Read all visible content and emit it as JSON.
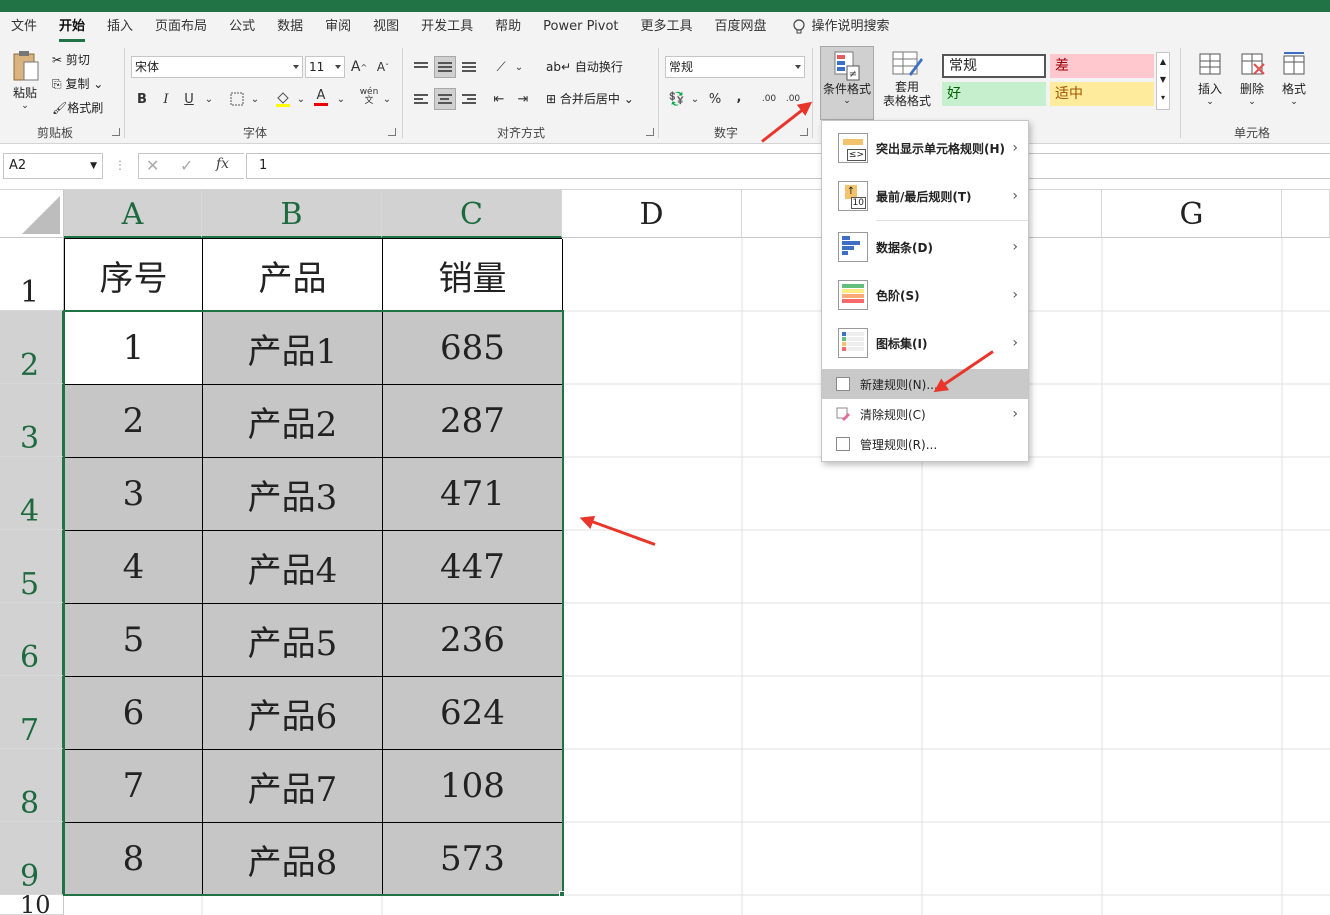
{
  "ribbon_tabs": [
    "文件",
    "开始",
    "插入",
    "页面布局",
    "公式",
    "数据",
    "审阅",
    "视图",
    "开发工具",
    "帮助",
    "Power Pivot",
    "更多工具",
    "百度网盘"
  ],
  "active_tab": "开始",
  "search_label": "操作说明搜索",
  "clipboard": {
    "paste": "粘贴",
    "cut": "剪切",
    "copy": "复制",
    "format_painter": "格式刷",
    "group": "剪贴板"
  },
  "font": {
    "name": "宋体",
    "size": "11",
    "group": "字体",
    "grow": "A",
    "shrink": "A",
    "bold": "B",
    "italic": "I",
    "underline": "U",
    "font_color": "A",
    "phonetic": "wén"
  },
  "alignment": {
    "wrap": "自动换行",
    "merge": "合并后居中",
    "group": "对齐方式"
  },
  "number": {
    "format": "常规",
    "percent": "%",
    "comma": ",",
    "inc_decimal": ".00",
    "dec_decimal": ".00",
    "group": "数字"
  },
  "styles": {
    "conditional": "条件格式",
    "table_format_1": "套用",
    "table_format_2": "表格格式",
    "normal": "常规",
    "bad": "差",
    "good": "好",
    "neutral": "适中"
  },
  "cells": {
    "insert": "插入",
    "delete": "删除",
    "format": "格式",
    "group": "单元格"
  },
  "formula_bar": {
    "name_box": "A2",
    "value": "1",
    "fx": "fx"
  },
  "columns": [
    "A",
    "B",
    "C",
    "D",
    "",
    "G"
  ],
  "rows": [
    "1",
    "2",
    "3",
    "4",
    "5",
    "6",
    "7",
    "8",
    "9",
    "10"
  ],
  "table": {
    "headers": [
      "序号",
      "产品",
      "销量"
    ],
    "rows": [
      [
        "1",
        "产品1",
        "685"
      ],
      [
        "2",
        "产品2",
        "287"
      ],
      [
        "3",
        "产品3",
        "471"
      ],
      [
        "4",
        "产品4",
        "447"
      ],
      [
        "5",
        "产品5",
        "236"
      ],
      [
        "6",
        "产品6",
        "624"
      ],
      [
        "7",
        "产品7",
        "108"
      ],
      [
        "8",
        "产品8",
        "573"
      ]
    ]
  },
  "cf_menu": {
    "highlight": "突出显示单元格规则(H)",
    "topbottom": "最前/最后规则(T)",
    "databar": "数据条(D)",
    "colorscale": "色阶(S)",
    "iconset": "图标集(I)",
    "new_rule": "新建规则(N)...",
    "clear_rules": "清除规则(C)",
    "manage_rules": "管理规则(R)..."
  },
  "colors": {
    "accent": "#217346",
    "selection": "#c6c6c6",
    "arrow": "#e8362b",
    "bad_bg": "#ffc7ce",
    "good_bg": "#c6efce",
    "neutral_bg": "#ffeb9c"
  }
}
